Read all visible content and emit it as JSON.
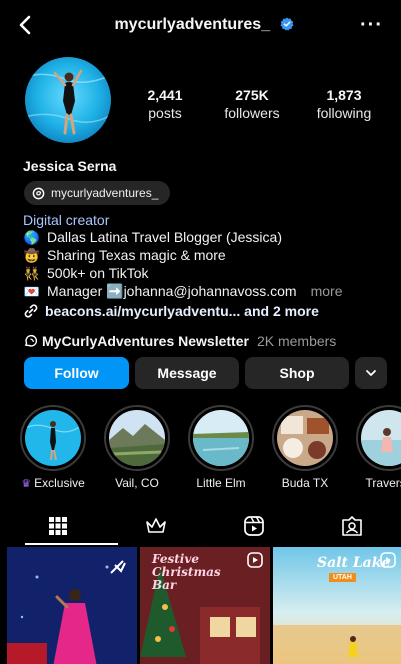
{
  "header": {
    "username": "mycurlyadventures_",
    "more_glyph": "···",
    "back_icon": "chevron-left-icon",
    "verified_icon": "verified-badge-icon"
  },
  "stats": [
    {
      "value": "2,441",
      "label": "posts"
    },
    {
      "value": "275K",
      "label": "followers"
    },
    {
      "value": "1,873",
      "label": "following"
    }
  ],
  "profile": {
    "full_name": "Jessica Serna",
    "threads_handle": "mycurlyadventures_",
    "category": "Digital creator",
    "bio": [
      {
        "emoji": "🌎",
        "text": "Dallas Latina Travel Blogger (Jessica)"
      },
      {
        "emoji": "🤠",
        "text": "Sharing Texas magic & more"
      },
      {
        "emoji": "👯",
        "text": "500k+ on TikTok"
      },
      {
        "emoji": "💌",
        "text": "Manager ➡️johanna@johannavoss.com"
      }
    ],
    "bio_more": "more",
    "link_text": "beacons.ai/mycurlyadventu... and 2 more",
    "newsletter_name": "MyCurlyAdventures Newsletter",
    "newsletter_members": "2K members"
  },
  "buttons": {
    "follow": "Follow",
    "message": "Message",
    "shop": "Shop"
  },
  "highlights": [
    {
      "label": "Exclusive",
      "crown": "♛"
    },
    {
      "label": "Vail, CO"
    },
    {
      "label": "Little Elm"
    },
    {
      "label": "Buda TX"
    },
    {
      "label": "Traverse"
    }
  ],
  "tabs": [
    "grid-icon",
    "crown-icon",
    "reels-icon",
    "tagged-icon"
  ],
  "posts": [
    {
      "overlay": ""
    },
    {
      "overlay": "Festive Christmas Bar"
    },
    {
      "overlay": "Salt Lake",
      "sub": "UTAH"
    }
  ],
  "colors": {
    "accent": "#0095f6",
    "link": "#a8c7ff",
    "button_bg": "#262626",
    "background": "#000000"
  }
}
